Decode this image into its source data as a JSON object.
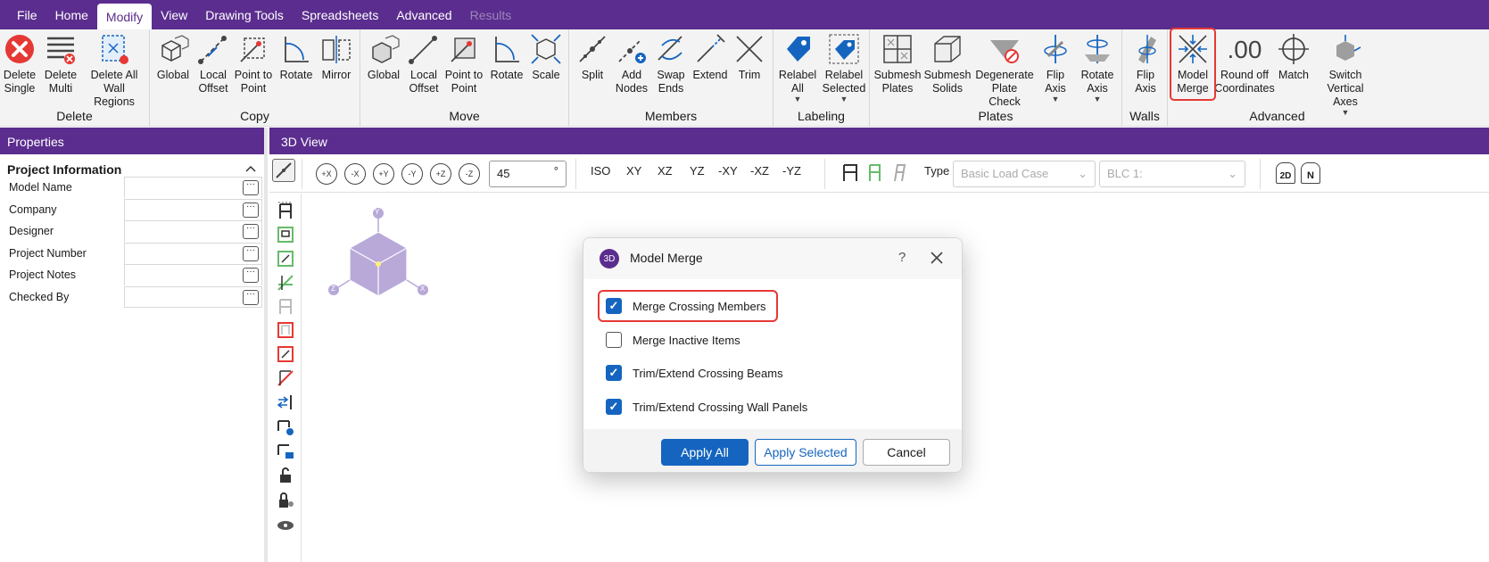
{
  "menu": {
    "tabs": [
      "File",
      "Home",
      "Modify",
      "View",
      "Drawing Tools",
      "Spreadsheets",
      "Advanced",
      "Results"
    ],
    "active": "Modify",
    "disabled": "Results"
  },
  "ribbon": {
    "delete": {
      "label": "Delete",
      "buttons": [
        "Delete Single",
        "Delete Multi",
        "Delete All Wall Regions"
      ]
    },
    "copy": {
      "label": "Copy",
      "buttons": [
        "Global",
        "Local Offset",
        "Point to Point",
        "Rotate",
        "Mirror"
      ]
    },
    "move": {
      "label": "Move",
      "buttons": [
        "Global",
        "Local Offset",
        "Point to Point",
        "Rotate",
        "Scale"
      ]
    },
    "members": {
      "label": "Members",
      "buttons": [
        "Split",
        "Add Nodes",
        "Swap Ends",
        "Extend",
        "Trim"
      ]
    },
    "labeling": {
      "label": "Labeling",
      "buttons": [
        "Relabel All",
        "Relabel Selected"
      ]
    },
    "plates": {
      "label": "Plates",
      "buttons": [
        "Submesh Plates",
        "Submesh Solids",
        "Degenerate Plate Check",
        "Flip Axis",
        "Rotate Axis"
      ]
    },
    "walls": {
      "label": "Walls",
      "buttons": [
        "Flip Axis"
      ]
    },
    "advanced": {
      "label": "Advanced",
      "buttons": [
        "Model Merge",
        "Round off Coordinates",
        "Match",
        "Switch Vertical Axes"
      ],
      "round_icon_text": ".00"
    }
  },
  "properties": {
    "header": "Properties",
    "section": "Project Information",
    "fields": [
      "Model Name",
      "Company",
      "Designer",
      "Project Number",
      "Project Notes",
      "Checked By"
    ],
    "dots": "···"
  },
  "view": {
    "header": "3D View",
    "rotate_buttons": [
      "+X",
      "-X",
      "+Y",
      "-Y",
      "+Z",
      "-Z"
    ],
    "angle": "45",
    "angle_unit": "°",
    "view_buttons": [
      "ISO",
      "XY",
      "XZ",
      "YZ",
      "-XY",
      "-XZ",
      "-YZ"
    ],
    "type_label": "Type",
    "type_select": "Basic Load Case",
    "blc_select": "BLC 1:",
    "toggle_2d": "2D",
    "toggle_n": "N",
    "cube_axes": [
      "Y",
      "Z",
      "X"
    ]
  },
  "dialog": {
    "logo": "3D",
    "title": "Model Merge",
    "help": "?",
    "options": [
      {
        "label": "Merge Crossing Members",
        "checked": true
      },
      {
        "label": "Merge Inactive Items",
        "checked": false
      },
      {
        "label": "Trim/Extend Crossing Beams",
        "checked": true
      },
      {
        "label": "Trim/Extend Crossing Wall Panels",
        "checked": true
      }
    ],
    "buttons": {
      "apply_all": "Apply All",
      "apply_selected": "Apply Selected",
      "cancel": "Cancel"
    }
  },
  "colors": {
    "brand": "#5b2d8e",
    "accent": "#1565c0",
    "highlight": "#e53935"
  }
}
